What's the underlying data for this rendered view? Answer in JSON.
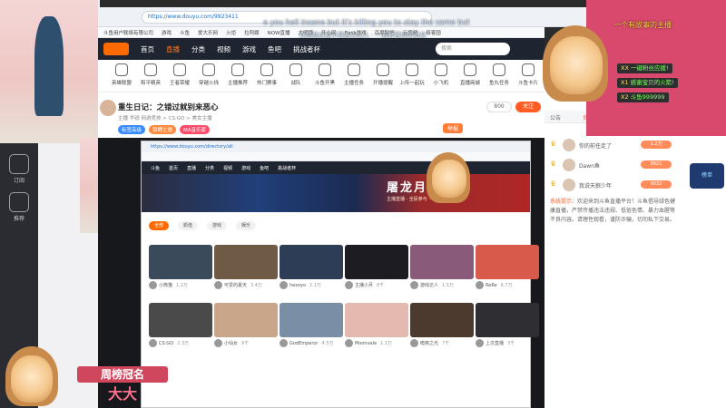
{
  "browser": {
    "url": "https://www.douyu.com/9923411",
    "url_display": "https://www.douyu.com/9923411"
  },
  "bookmarks": [
    "斗鱼用户联络有限公司",
    "游戏",
    "斗鱼",
    "爱大乐网",
    "火炬",
    "拉阿娱",
    "NOW直播",
    "大明镜",
    "开心网",
    "Rock游戏",
    "百度贴吧",
    "云视频",
    "极客园"
  ],
  "nav": {
    "logo": "斗鱼",
    "items": [
      "首页",
      "直播",
      "分类",
      "视频",
      "游戏",
      "鱼吧",
      "挑战者杯"
    ],
    "active_index": 1,
    "search_placeholder": "搜索"
  },
  "categories": [
    "英雄联盟",
    "和平精英",
    "王者荣耀",
    "穿越火线",
    "主播推荐",
    "热门赛事",
    "战队",
    "斗鱼开黑",
    "主播任务",
    "开播提醒",
    "上传一起玩",
    "小飞机",
    "直播商城",
    "鱼丸任务",
    "斗鱼卡片"
  ],
  "room": {
    "title": "重生日记：之错过就别来恶心",
    "meta": "主播  华锐  网游竞技 > CS:GO > 美女主播",
    "tags": [
      "标签高级",
      "锦鲤主播",
      "MA音乐家"
    ],
    "subscribe_label": "关注",
    "follow_count": "800",
    "report_label": "举报"
  },
  "inner": {
    "url": "https://www.douyu.com/directory/all",
    "nav_items": [
      "斗鱼",
      "首页",
      "直播",
      "分类",
      "视频",
      "游戏",
      "鱼吧",
      "挑战者杯"
    ],
    "banner_title": "屠龙月主",
    "banner_sub": "主播直播 · 全民参与 · 丰厚奖励",
    "pills": [
      "全部",
      "颜值",
      "游戏",
      "娱乐"
    ],
    "cards": [
      {
        "name": "小熊猫",
        "viewers": "1.2万"
      },
      {
        "name": "可爱的夏天",
        "viewers": "3.4万"
      },
      {
        "name": "hexoyo",
        "viewers": "2.1万"
      },
      {
        "name": "主播小月",
        "viewers": "8千"
      },
      {
        "name": "游戏达人",
        "viewers": "1.5万"
      },
      {
        "name": "ReRe",
        "viewers": "6.7万"
      },
      {
        "name": "CS:GO",
        "viewers": "2.3万"
      },
      {
        "name": "小仙女",
        "viewers": "9千"
      },
      {
        "name": "GodEmperor",
        "viewers": "4.5万"
      },
      {
        "name": "Moonvale",
        "viewers": "1.1万"
      },
      {
        "name": "暗夜之光",
        "viewers": "7千"
      },
      {
        "name": "上次直播",
        "viewers": "3千"
      }
    ]
  },
  "right": {
    "tabs": [
      "公告",
      "贡献周榜",
      "粉丝团",
      "贵宾",
      "VIP"
    ],
    "rank": [
      {
        "name": "你的前任走了",
        "badge": "1.2万"
      },
      {
        "name": "Dawn鱼",
        "badge": "8921"
      },
      {
        "name": "我说天狼少年",
        "badge": "6032"
      }
    ],
    "system_label": "系统提示：",
    "system_text": "欢迎来到斗鱼直播平台！斗鱼倡导绿色健康直播，严禁传播违法违规、低俗色情、暴力血腥等不良内容。请理性观看，谨防诈骗，切勿私下交易。"
  },
  "overlay": {
    "danmaku": [
      "e you hell insane but it's killing you to stay the same but",
      "你是我这辈子最难忘的人 · 一直在等你的消息",
      "一个有故事的主播"
    ],
    "chat": [
      {
        "user": "XX",
        "msg": "一键粉丝应援!"
      },
      {
        "user": "X1",
        "msg": "感谢宝贝的火箭!"
      },
      {
        "user": "X2",
        "msg": "斗鱼999999"
      }
    ],
    "rank_name": "周榜冠名",
    "rank_user": "大大",
    "rt_badge": "榜单"
  },
  "sidebar": {
    "items": [
      "订阅",
      "推荐"
    ]
  },
  "watermark": "斗鱼",
  "colors": {
    "accent": "#ff6a00",
    "nav_bg": "#1f2530",
    "pink": "#d9486d"
  }
}
